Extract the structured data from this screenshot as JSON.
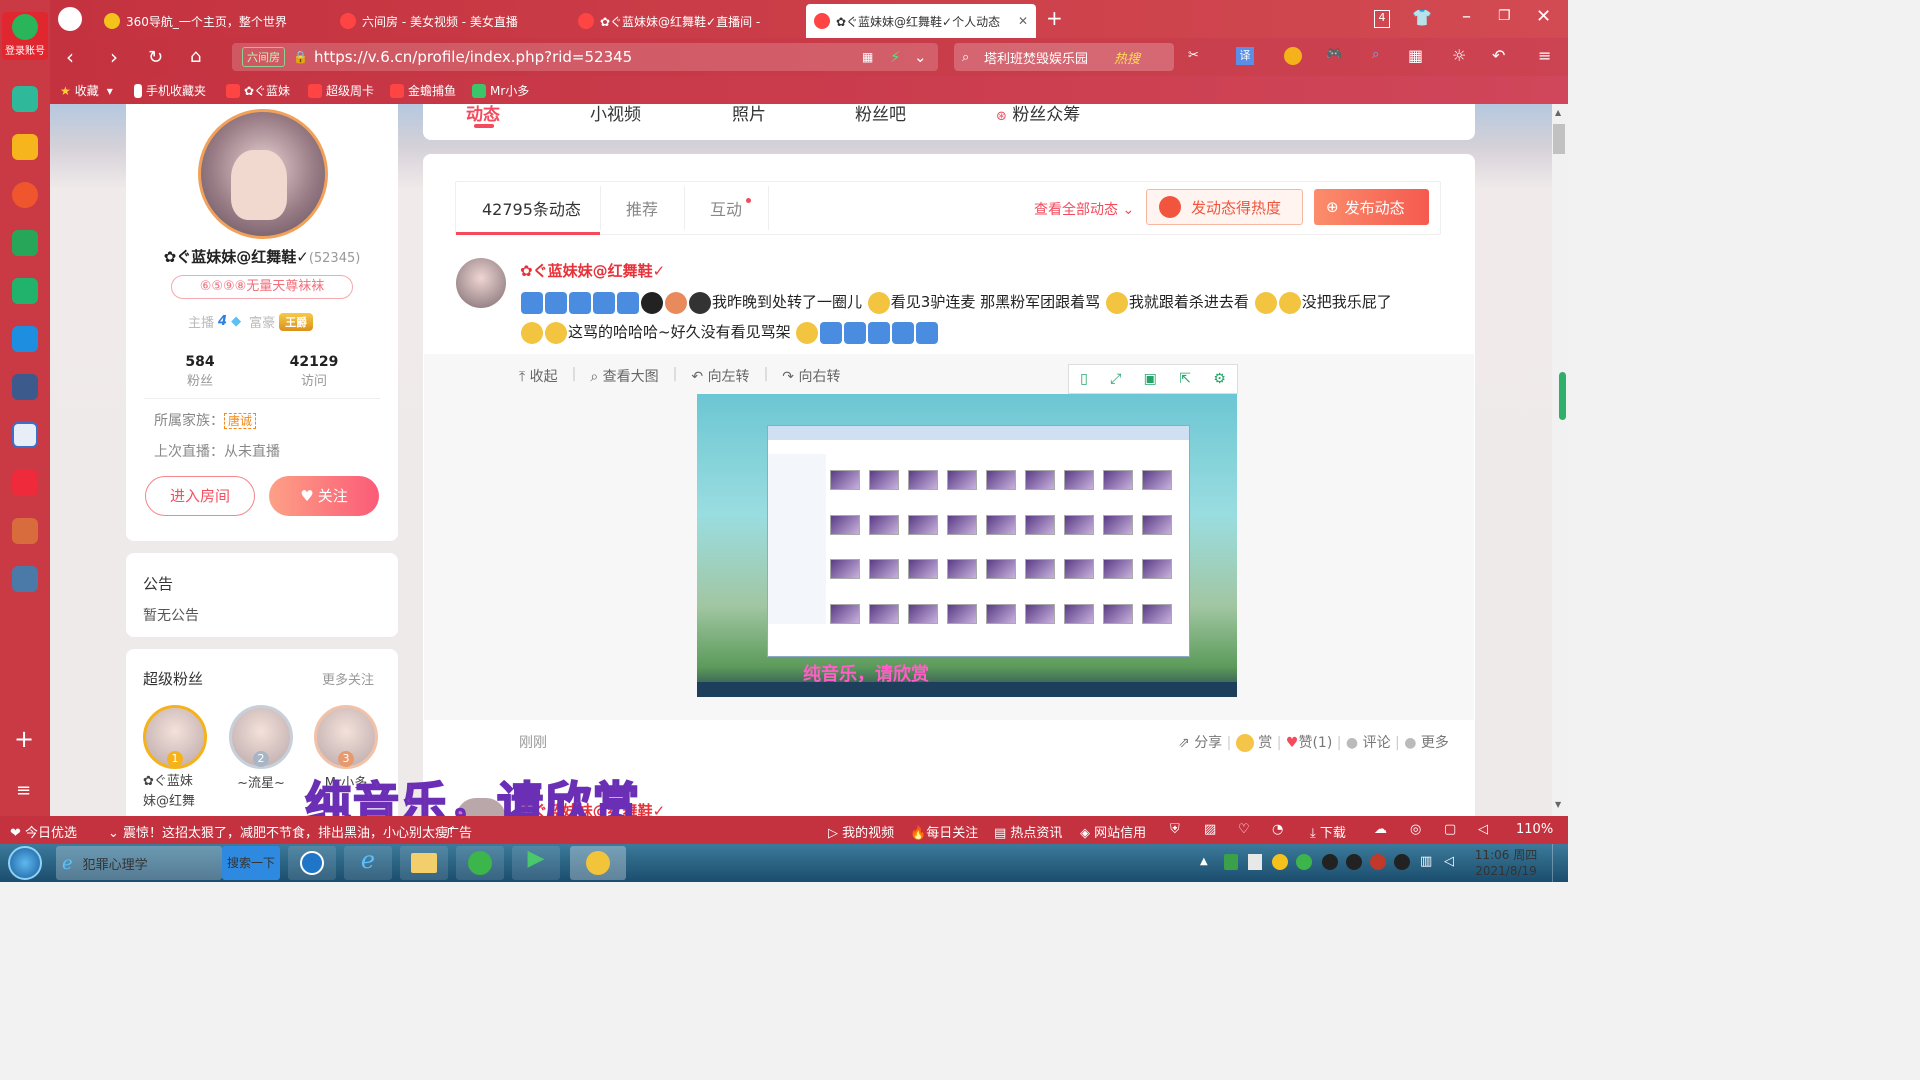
{
  "browser": {
    "login_label": "登录账号",
    "tabs": [
      {
        "label": "360导航_一个主页，整个世界"
      },
      {
        "label": "六间房 - 美女视频 - 美女直播"
      },
      {
        "label": "✿ぐ蓝妹妹@红舞鞋✓直播间 -"
      },
      {
        "label": "✿ぐ蓝妹妹@红舞鞋✓个人动态"
      }
    ],
    "tab_count": "4",
    "url": "https://v.6.cn/profile/index.php?rid=52345",
    "url_badge": "六间房",
    "search_text": "塔利班焚毁娱乐园",
    "search_hot": "热搜",
    "translate": "译",
    "bookmarks": [
      "收藏",
      "手机收藏夹",
      "✿ぐ蓝妹",
      "超级周卡",
      "金蟾捕鱼",
      "Mr小多"
    ]
  },
  "page_nav": {
    "items": [
      "动态",
      "小视频",
      "照片",
      "粉丝吧",
      "粉丝众筹"
    ]
  },
  "profile": {
    "name": "✿ぐ蓝妹妹@红舞鞋✓",
    "rid": "(52345)",
    "rank_title": "⑥⑤⑨⑧无量天尊袜袜",
    "host_label": "主播",
    "host_level": "4",
    "rich_label": "富豪",
    "rich_level": "王爵",
    "fans_count": "584",
    "fans_label": "粉丝",
    "visits_count": "42129",
    "visits_label": "访问",
    "family_label": "所属家族：",
    "family_value": "唐诚",
    "last_live": "上次直播：从未直播",
    "enter_room": "进入房间",
    "follow": "关注"
  },
  "notice": {
    "title": "公告",
    "content": "暂无公告"
  },
  "super_fans": {
    "title": "超级粉丝",
    "more": "更多关注",
    "fans": [
      {
        "rank": "1",
        "name": "✿ぐ蓝妹\n妹@红舞",
        "color": "#f5b21b"
      },
      {
        "rank": "2",
        "name": "~流星~",
        "color": "#a8b5c4"
      },
      {
        "rank": "3",
        "name": "Mr小多",
        "color": "#e59a6f"
      }
    ]
  },
  "feed": {
    "tabs": [
      "42795条动态",
      "推荐",
      "互动"
    ],
    "view_all": "查看全部动态",
    "heat_btn": "发动态得热度",
    "post_btn": "发布动态",
    "post": {
      "author": "✿ぐ蓝妹妹@红舞鞋✓",
      "text_1": "我昨晚到处转了一圈儿",
      "text_2": "看见3驴连麦 那黑粉军团跟着骂",
      "text_3": "我就跟着杀进去看",
      "text_4": "没把我乐屁了",
      "text_5": "这骂的哈哈哈~好久没有看见骂架",
      "image_tools": [
        "收起",
        "查看大图",
        "向左转",
        "向右转"
      ],
      "image_caption": "纯音乐，请欣赏",
      "time": "刚刚",
      "share": "分享",
      "reward": "赏",
      "like": "赞(1)",
      "comment": "评论",
      "more": "更多"
    }
  },
  "lyric_overlay": "纯音乐，请欣赏",
  "statusbar": {
    "news_label": "今日优选",
    "news_text": "震惊！这招太狠了，减肥不节食，排出黑油，小心别太瘦！",
    "ad": "广告",
    "items": [
      "我的视频",
      "每日关注",
      "热点资讯",
      "网站信用",
      "下载"
    ],
    "zoom": "110%"
  },
  "taskbar": {
    "task1": "犯罪心理学",
    "search_btn": "搜索一下",
    "clock_time": "11:06 周四",
    "clock_date": "2021/8/19"
  }
}
